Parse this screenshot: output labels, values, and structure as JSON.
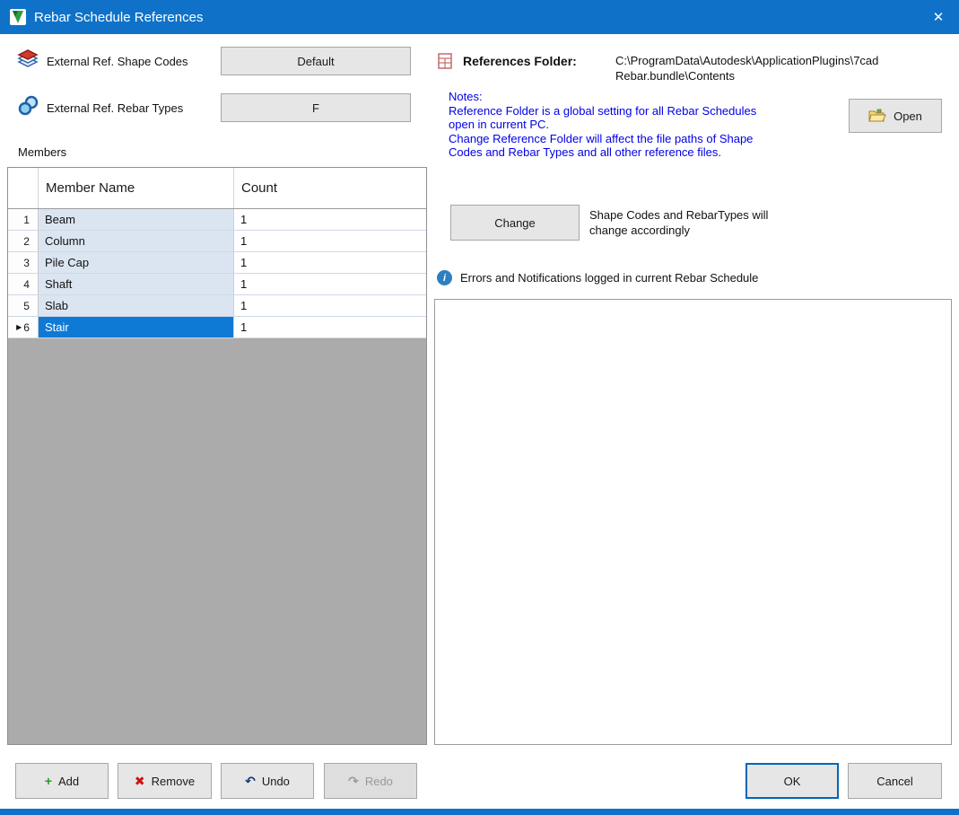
{
  "window": {
    "title": "Rebar Schedule References"
  },
  "icons": {
    "close": "✕",
    "row_marker": "▶",
    "add": "+",
    "remove": "✖",
    "undo": "↶",
    "redo": "↷",
    "info": "i"
  },
  "left": {
    "shape_codes_label": "External Ref. Shape Codes",
    "shape_codes_value": "Default",
    "rebar_types_label": "External Ref. Rebar Types",
    "rebar_types_value": "F",
    "members_label": "Members",
    "grid": {
      "columns": {
        "name": "Member Name",
        "count": "Count"
      },
      "rows": [
        {
          "num": "1",
          "name": "Beam",
          "count": "1"
        },
        {
          "num": "2",
          "name": "Column",
          "count": "1"
        },
        {
          "num": "3",
          "name": "Pile Cap",
          "count": "1"
        },
        {
          "num": "4",
          "name": "Shaft",
          "count": "1"
        },
        {
          "num": "5",
          "name": "Slab",
          "count": "1"
        },
        {
          "num": "6",
          "name": "Stair",
          "count": "1"
        }
      ],
      "selected_row_num": "6"
    }
  },
  "right": {
    "references_folder_label": "References Folder:",
    "references_folder_value": "C:\\ProgramData\\Autodesk\\ApplicationPlugins\\7cad Rebar.bundle\\Contents",
    "notes_title": "Notes:",
    "notes_line1": "Reference Folder is a global setting for all Rebar Schedules open in current PC.",
    "notes_line2": "Change Reference Folder will affect the file paths of Shape Codes and Rebar Types and all other reference files.",
    "open_button": "Open",
    "change_button": "Change",
    "change_note": "Shape Codes and RebarTypes will change accordingly",
    "log_label": "Errors and Notifications logged in current Rebar Schedule"
  },
  "footer": {
    "add": "Add",
    "remove": "Remove",
    "undo": "Undo",
    "redo": "Redo",
    "ok": "OK",
    "cancel": "Cancel"
  },
  "colors": {
    "titlebar": "#0f72c8",
    "selection": "#0f7ad6",
    "notes_text": "#0000e8",
    "name_cell_bg": "#dbe5f1",
    "grid_filler": "#ababab",
    "ok_border": "#0066b8"
  }
}
